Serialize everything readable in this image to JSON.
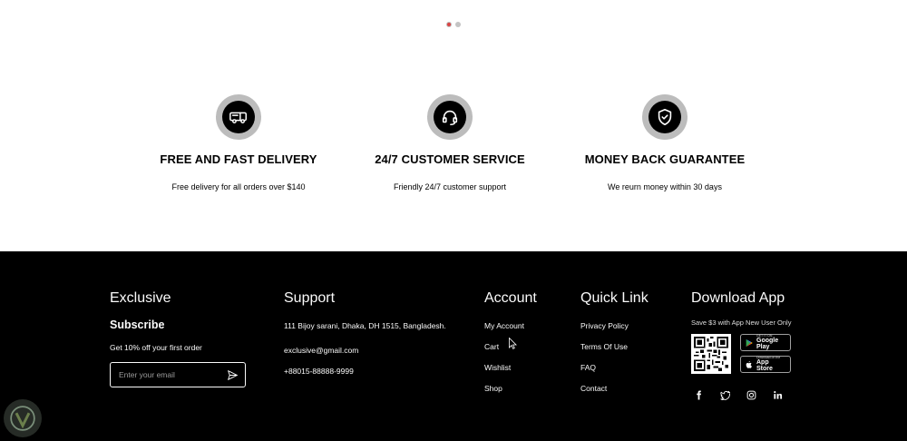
{
  "carousel": {
    "dots": 2,
    "active_index": 0
  },
  "services": [
    {
      "icon": "delivery-van-icon",
      "title": "FREE AND FAST DELIVERY",
      "desc": "Free delivery for all orders over $140"
    },
    {
      "icon": "headset-icon",
      "title": "24/7 CUSTOMER SERVICE",
      "desc": "Friendly 24/7 customer support"
    },
    {
      "icon": "shield-check-icon",
      "title": "MONEY BACK GUARANTEE",
      "desc": "We reurn money within 30 days"
    }
  ],
  "footer": {
    "exclusive": {
      "title": "Exclusive",
      "subscribe": "Subscribe",
      "offer": "Get 10% off your first order",
      "email_placeholder": "Enter your email"
    },
    "support": {
      "title": "Support",
      "address": "111 Bijoy sarani, Dhaka, DH 1515, Bangladesh.",
      "email": "exclusive@gmail.com",
      "phone": "+88015-88888-9999"
    },
    "account": {
      "title": "Account",
      "links": [
        "My Account",
        "Cart",
        "Wishlist",
        "Shop"
      ]
    },
    "quick_link": {
      "title": "Quick Link",
      "links": [
        "Privacy Policy",
        "Terms Of Use",
        "FAQ",
        "Contact"
      ]
    },
    "download_app": {
      "title": "Download App",
      "promo": "Save $3 with App New User Only",
      "google_play": {
        "small": "GET IT ON",
        "big": "Google Play"
      },
      "app_store": {
        "small": "Download on the",
        "big": "App Store"
      }
    },
    "socials": [
      "facebook-icon",
      "twitter-icon",
      "instagram-icon",
      "linkedin-icon"
    ]
  },
  "colors": {
    "accent": "#db4444",
    "footer_bg": "#000000",
    "icon_ring": "#bcbcbc"
  }
}
